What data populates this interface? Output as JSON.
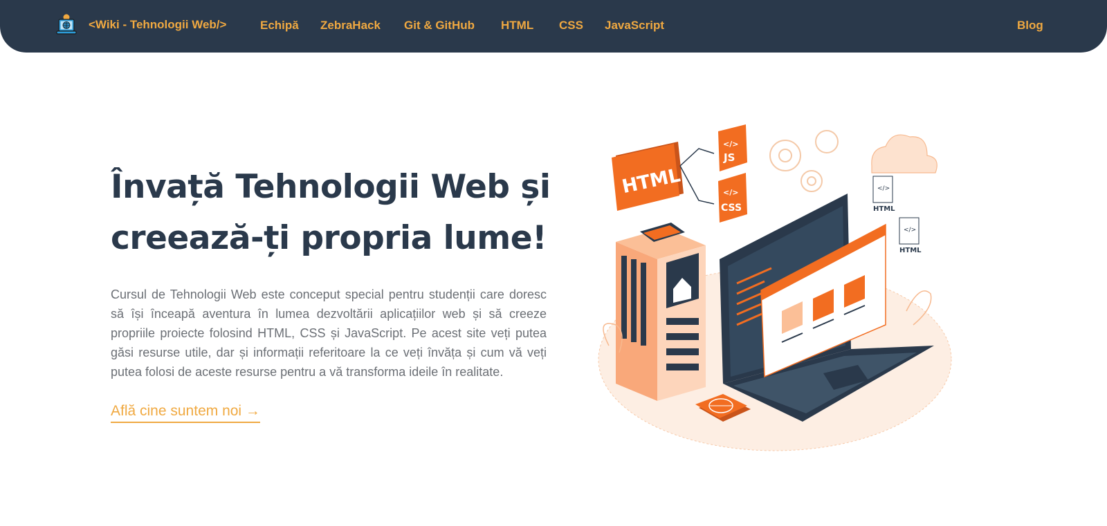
{
  "navbar": {
    "brand_text": "<Wiki - Tehnologii Web/>",
    "links": [
      "Echipă",
      "ZebraHack",
      "Git & GitHub",
      "HTML",
      "CSS",
      "JavaScript"
    ],
    "blog": "Blog"
  },
  "hero": {
    "title": "Învață Tehnologii Web și creează-ți propria lume!",
    "description": "Cursul de Tehnologii Web este conceput special pentru studenții care doresc să își înceapă aventura în lumea dezvoltării aplicațiilor web și să creeze propriile proiecte folosind HTML, CSS și JavaScript. Pe acest site veți putea găsi resurse utile, dar și informații referitoare la ce veți învăța și cum vă veți putea folosi de aceste resurse pentru a vă transforma ideile în realitate.",
    "cta": "Află cine suntem noi →"
  },
  "illustration": {
    "labels": {
      "html_badge": "HTML",
      "js_badge": "JS",
      "css_badge": "CSS",
      "code_glyph": "</>",
      "html_file_1": "HTML",
      "html_file_2": "HTML"
    }
  },
  "colors": {
    "nav_bg": "#2a394b",
    "accent": "#f0a941",
    "title": "#2a394b",
    "body_text": "#6b6f75",
    "orange": "#f26d21"
  },
  "icons": {
    "brand_logo": "laptop-globe-icon"
  }
}
